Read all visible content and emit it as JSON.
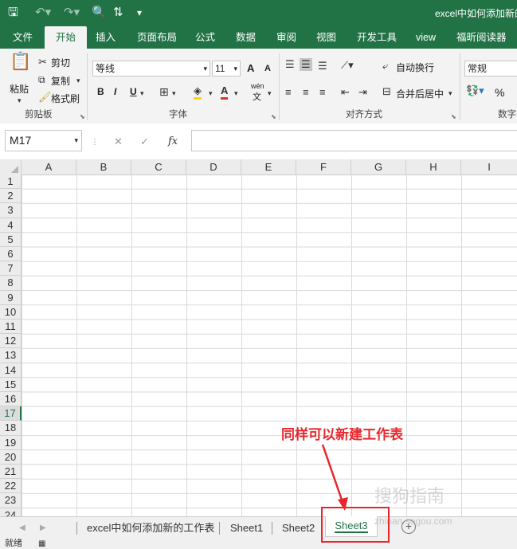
{
  "title_bar": {
    "doc_title": "excel中如何添加新的",
    "save_icon": "save-icon",
    "undo_icon": "undo-icon",
    "redo_icon": "redo-icon",
    "preview_icon": "print-preview-icon",
    "sort_icon": "sort-icon",
    "customize_icon": "customize-quick-access-icon"
  },
  "tabs": [
    {
      "label": "文件"
    },
    {
      "label": "开始"
    },
    {
      "label": "插入"
    },
    {
      "label": "页面布局"
    },
    {
      "label": "公式"
    },
    {
      "label": "数据"
    },
    {
      "label": "审阅"
    },
    {
      "label": "视图"
    },
    {
      "label": "开发工具"
    },
    {
      "label": "view"
    },
    {
      "label": "福昕阅读器"
    }
  ],
  "active_tab": "开始",
  "ribbon": {
    "clipboard": {
      "paste": "粘贴",
      "cut": "剪切",
      "copy": "复制",
      "format_painter": "格式刷",
      "group": "剪贴板"
    },
    "font": {
      "name": "等线",
      "size": "11",
      "bold": "B",
      "italic": "I",
      "underline": "U",
      "group": "字体",
      "grow": "A",
      "shrink": "A",
      "phonetic": "wén",
      "phonetic2": "文"
    },
    "alignment": {
      "wrap": "自动换行",
      "merge": "合并后居中",
      "group": "对齐方式"
    },
    "number": {
      "format": "常规",
      "percent": "%",
      "group": "数字"
    }
  },
  "formula_bar": {
    "name_box": "M17",
    "cancel": "✕",
    "enter": "✓",
    "fx": "fx"
  },
  "columns": [
    "A",
    "B",
    "C",
    "D",
    "E",
    "F",
    "G",
    "H",
    "I"
  ],
  "rows": [
    "1",
    "2",
    "3",
    "4",
    "5",
    "6",
    "7",
    "8",
    "9",
    "10",
    "11",
    "12",
    "13",
    "14",
    "15",
    "16",
    "17",
    "18",
    "19",
    "20",
    "21",
    "22",
    "23",
    "24"
  ],
  "selected_row": "17",
  "sheets": [
    {
      "label": "excel中如何添加新的工作表"
    },
    {
      "label": "Sheet1"
    },
    {
      "label": "Sheet2"
    },
    {
      "label": "Sheet3"
    }
  ],
  "active_sheet": "Sheet3",
  "add_sheet": "+",
  "status": {
    "ready": "就绪"
  },
  "annotation": {
    "text": "同样可以新建工作表"
  },
  "watermark": {
    "brand": "搜狗指南",
    "url": "zhinan.sogou.com"
  },
  "colors": {
    "excel_green": "#217346",
    "annotation_red": "#e8262b"
  }
}
